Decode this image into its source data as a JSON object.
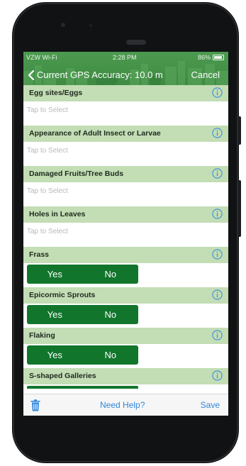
{
  "status_bar": {
    "carrier": "VZW Wi-Fi",
    "time": "2:28 PM",
    "battery": "86%"
  },
  "nav": {
    "title": "Current GPS Accuracy: 10.0 m",
    "cancel_label": "Cancel"
  },
  "sections": {
    "egg_sites": {
      "label": "Egg sites/Eggs",
      "placeholder": "Tap to Select"
    },
    "adult_insect": {
      "label": "Appearance of Adult Insect or Larvae",
      "placeholder": "Tap to Select"
    },
    "damaged_fruits": {
      "label": "Damaged Fruits/Tree Buds",
      "placeholder": "Tap to Select"
    },
    "holes_leaves": {
      "label": "Holes in Leaves",
      "placeholder": "Tap to Select"
    },
    "frass": {
      "label": "Frass",
      "yes": "Yes",
      "no": "No"
    },
    "epicormic": {
      "label": "Epicormic Sprouts",
      "yes": "Yes",
      "no": "No"
    },
    "flaking": {
      "label": "Flaking",
      "yes": "Yes",
      "no": "No"
    },
    "s_galleries": {
      "label": "S-shaped Galleries"
    }
  },
  "toolbar": {
    "help_label": "Need Help?",
    "save_label": "Save"
  },
  "colors": {
    "header_green": "#3f8a43",
    "section_green": "#c3ddb5",
    "toggle_green": "#11762c",
    "link_blue": "#2f86d9",
    "info_blue": "#3b8fd9"
  },
  "icons": [
    "back-chevron-icon",
    "info-icon",
    "trash-icon",
    "wifi-icon",
    "battery-icon"
  ]
}
